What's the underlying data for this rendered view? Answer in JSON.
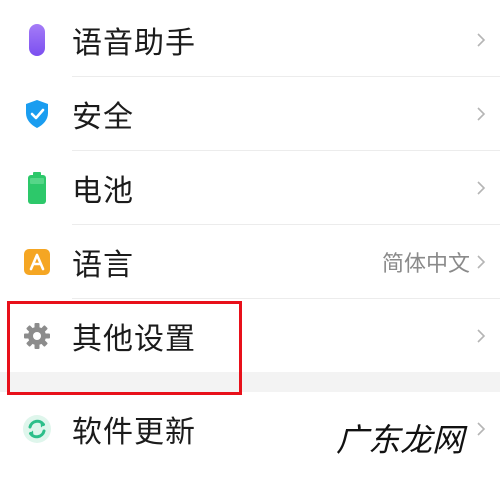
{
  "settings": {
    "items": [
      {
        "label": "语音助手",
        "icon": "microphone-icon",
        "value": ""
      },
      {
        "label": "安全",
        "icon": "shield-check-icon",
        "value": ""
      },
      {
        "label": "电池",
        "icon": "battery-icon",
        "value": ""
      },
      {
        "label": "语言",
        "icon": "language-a-icon",
        "value": "简体中文"
      },
      {
        "label": "其他设置",
        "icon": "gear-icon",
        "value": ""
      },
      {
        "label": "软件更新",
        "icon": "update-refresh-icon",
        "value": ""
      }
    ]
  },
  "watermark": {
    "text": "广东龙网"
  },
  "colors": {
    "microphone": "#8a5cf0",
    "shield": "#1a9df0",
    "battery": "#2dc86a",
    "language": "#f5a623",
    "gear": "#8c8c8c",
    "update": "#2dbf8a",
    "highlight": "#e8101a"
  }
}
